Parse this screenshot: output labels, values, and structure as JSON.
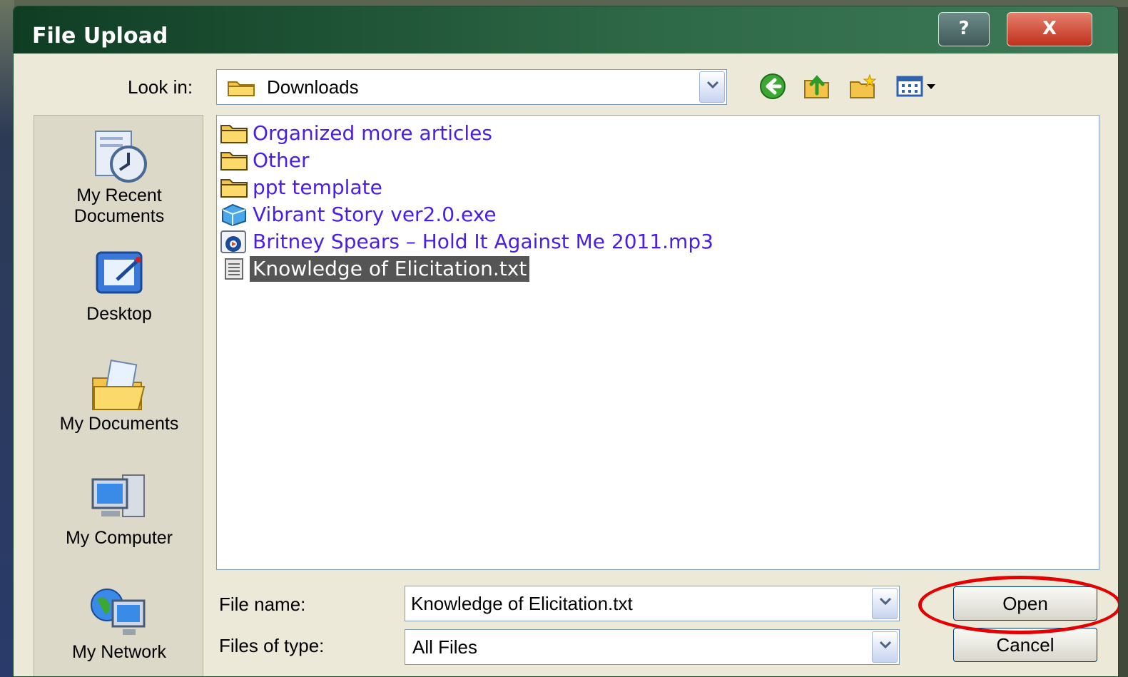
{
  "window": {
    "title": "File Upload",
    "help_label": "?",
    "close_label": "X"
  },
  "look_in": {
    "label": "Look in:",
    "value": "Downloads"
  },
  "toolbar": {
    "icons": [
      "back-icon",
      "up-folder-icon",
      "new-folder-icon",
      "view-menu-icon"
    ]
  },
  "places": [
    {
      "label": "My Recent Documents",
      "icon": "recent-documents-icon"
    },
    {
      "label": "Desktop",
      "icon": "desktop-icon"
    },
    {
      "label": "My Documents",
      "icon": "my-documents-icon"
    },
    {
      "label": "My Computer",
      "icon": "my-computer-icon"
    },
    {
      "label": "My Network",
      "icon": "my-network-icon"
    }
  ],
  "files": [
    {
      "name": "Organized more articles",
      "icon": "folder-icon",
      "selected": false
    },
    {
      "name": "Other",
      "icon": "folder-icon",
      "selected": false
    },
    {
      "name": "ppt template",
      "icon": "folder-icon",
      "selected": false
    },
    {
      "name": "Vibrant Story ver2.0.exe",
      "icon": "exe-icon",
      "selected": false
    },
    {
      "name": "Britney Spears – Hold It Against Me 2011.mp3",
      "icon": "audio-icon",
      "selected": false
    },
    {
      "name": "Knowledge of Elicitation.txt",
      "icon": "text-file-icon",
      "selected": true
    }
  ],
  "file_name": {
    "label": "File name:",
    "value": "Knowledge of Elicitation.txt"
  },
  "file_type": {
    "label": "Files of type:",
    "value": "All Files"
  },
  "buttons": {
    "open": "Open",
    "cancel": "Cancel"
  },
  "colors": {
    "titlebar": "#1d5234",
    "file_link": "#4a1ee8",
    "selection": "#555555",
    "highlight_ring": "#e40000"
  }
}
